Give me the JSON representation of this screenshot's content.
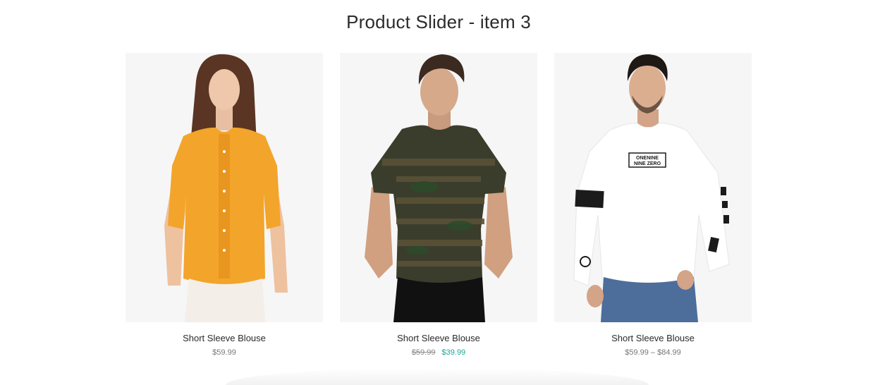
{
  "section": {
    "title": "Product Slider - item 3"
  },
  "products": [
    {
      "title": "Short Sleeve Blouse",
      "price": "$59.99",
      "image_desc": "woman in orange blouse",
      "garment_color": "#f3a42a"
    },
    {
      "title": "Short Sleeve Blouse",
      "price_old": "$59.99",
      "price_sale": "$39.99",
      "image_desc": "man in camo t-shirt",
      "garment_color": "#3b3d2c"
    },
    {
      "title": "Short Sleeve Blouse",
      "price": "$59.99 – $84.99",
      "image_desc": "man in white long sleeve",
      "garment_color": "#ffffff",
      "print_text_1": "ONENINE",
      "print_text_2": "NINE ZERO"
    }
  ],
  "colors": {
    "sale": "#1aa598",
    "image_bg": "#f6f6f6"
  }
}
